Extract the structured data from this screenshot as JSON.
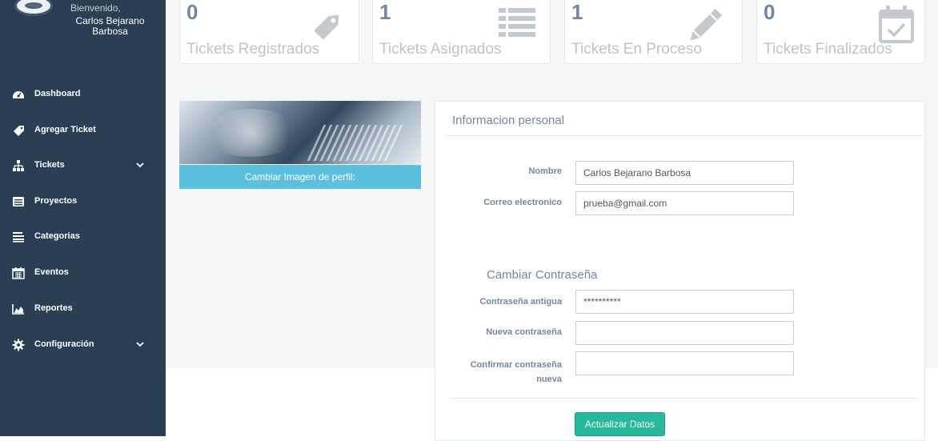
{
  "sidebar": {
    "welcome": "Bienvenido,",
    "user_name": "Carlos Bejarano Barbosa",
    "items": [
      {
        "label": "Dashboard",
        "icon": "dashboard-icon"
      },
      {
        "label": "Agregar Ticket",
        "icon": "tag-icon"
      },
      {
        "label": "Tickets",
        "icon": "sitemap-icon",
        "has_submenu": true
      },
      {
        "label": "Proyectos",
        "icon": "list-alt-icon"
      },
      {
        "label": "Categorias",
        "icon": "align-justify-icon"
      },
      {
        "label": "Eventos",
        "icon": "calendar-icon"
      },
      {
        "label": "Reportes",
        "icon": "area-chart-icon"
      },
      {
        "label": "Configuración",
        "icon": "gear-icon",
        "has_submenu": true
      }
    ]
  },
  "stats": [
    {
      "count": "0",
      "label": "Tickets Registrados",
      "icon": "tag-icon"
    },
    {
      "count": "1",
      "label": "Tickets Asignados",
      "icon": "list-icon"
    },
    {
      "count": "1",
      "label": "Tickets En Proceso",
      "icon": "pencil-icon"
    },
    {
      "count": "0",
      "label": "Tickets Finalizados",
      "icon": "calendar-check-icon"
    }
  ],
  "profile": {
    "change_image_label": "Cambiar Imagen de perfil:"
  },
  "personal": {
    "title": "Informacion personal",
    "name_label": "Nombre",
    "name_value": "Carlos Bejarano Barbosa",
    "email_label": "Correo electronico",
    "email_value": "prueba@gmail.com"
  },
  "password": {
    "title": "Cambiar Contraseña",
    "old_label": "Contraseña antigua",
    "old_value": "**********",
    "new_label": "Nueva contraseña",
    "new_value": "",
    "confirm_label_line1": "Confirmar contraseña",
    "confirm_label_line2": "nueva",
    "confirm_value": ""
  },
  "actions": {
    "submit_label": "Actualizar Datos"
  },
  "colors": {
    "sidebar_bg": "#2a3f54",
    "info_button": "#5bc0de",
    "success_button": "#26b99a",
    "muted_text": "#73879c"
  }
}
